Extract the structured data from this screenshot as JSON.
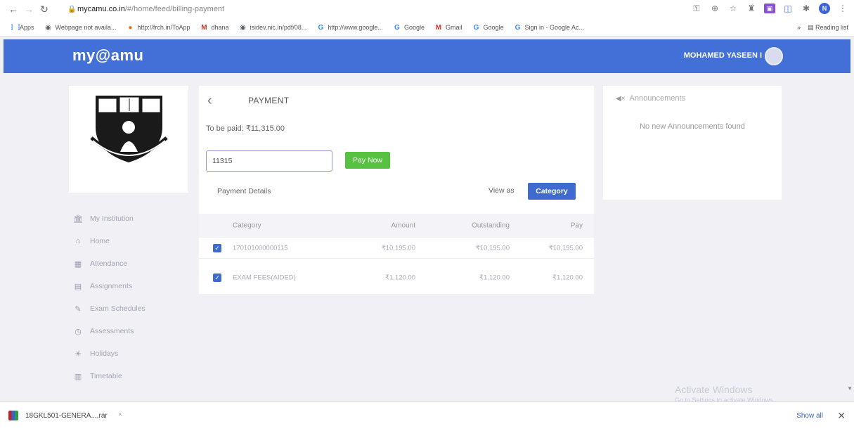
{
  "browser": {
    "url_host": "mycamu.co.in",
    "url_path": "/#/home/feed/billing-payment",
    "bookmarks": [
      {
        "icon": "apps-grid-icon",
        "label": "Apps"
      },
      {
        "icon": "globe-icon",
        "label": "Webpage not availa..."
      },
      {
        "icon": "orange-icon",
        "label": "http://frch.in/ToApp"
      },
      {
        "icon": "gmail-icon",
        "label": "dhana"
      },
      {
        "icon": "globe-icon",
        "label": "isidev.nic.in/pdf/08..."
      },
      {
        "icon": "google-icon",
        "label": "http://www.google..."
      },
      {
        "icon": "google-icon",
        "label": "Google"
      },
      {
        "icon": "gmail-icon",
        "label": "Gmail"
      },
      {
        "icon": "google-icon",
        "label": "Google"
      },
      {
        "icon": "google-icon",
        "label": "Sign in - Google Ac..."
      }
    ],
    "more_bookmarks": "»",
    "reading_list": "Reading list",
    "profile_initial": "N"
  },
  "header": {
    "brand": "my@amu",
    "user_name": "MOHAMED YASEEN I"
  },
  "sidebar": {
    "items": [
      {
        "icon": "institution-icon",
        "glyph": "🏛",
        "label": "My Institution"
      },
      {
        "icon": "home-icon",
        "glyph": "⌂",
        "label": "Home"
      },
      {
        "icon": "attendance-icon",
        "glyph": "▦",
        "label": "Attendance"
      },
      {
        "icon": "assignments-icon",
        "glyph": "▤",
        "label": "Assignments"
      },
      {
        "icon": "exam-schedules-icon",
        "glyph": "✎",
        "label": "Exam Schedules"
      },
      {
        "icon": "assessments-icon",
        "glyph": "◷",
        "label": "Assessments"
      },
      {
        "icon": "holidays-icon",
        "glyph": "☀",
        "label": "Holidays"
      },
      {
        "icon": "timetable-icon",
        "glyph": "▥",
        "label": "Timetable"
      }
    ]
  },
  "payment": {
    "title": "PAYMENT",
    "to_be_paid": "To be paid: ₹11,315.00",
    "amount_value": "11315",
    "pay_now_label": "Pay Now",
    "details_label": "Payment Details",
    "view_as_label": "View as",
    "category_button": "Category",
    "table": {
      "headers": [
        "Category",
        "Amount",
        "Outstanding",
        "Pay"
      ],
      "rows": [
        {
          "category": "170101000000115",
          "amount": "₹10,195.00",
          "outstanding": "₹10,195.00",
          "pay": "₹10,195.00",
          "checked": true
        },
        {
          "category": "EXAM FEES(AIDED)",
          "amount": "₹1,120.00",
          "outstanding": "₹1,120.00",
          "pay": "₹1,120.00",
          "checked": true
        }
      ]
    }
  },
  "announcements": {
    "title": "Announcements",
    "empty_text": "No new Announcements found"
  },
  "watermark": {
    "title": "Activate Windows",
    "subtitle": "Go to Settings to activate Windows."
  },
  "download": {
    "file_name": "18GKL501-GENERA....rar",
    "show_all": "Show all"
  },
  "colors": {
    "header_blue": "#4270d6",
    "pay_green": "#57c242",
    "category_blue": "#3f6bd0"
  }
}
